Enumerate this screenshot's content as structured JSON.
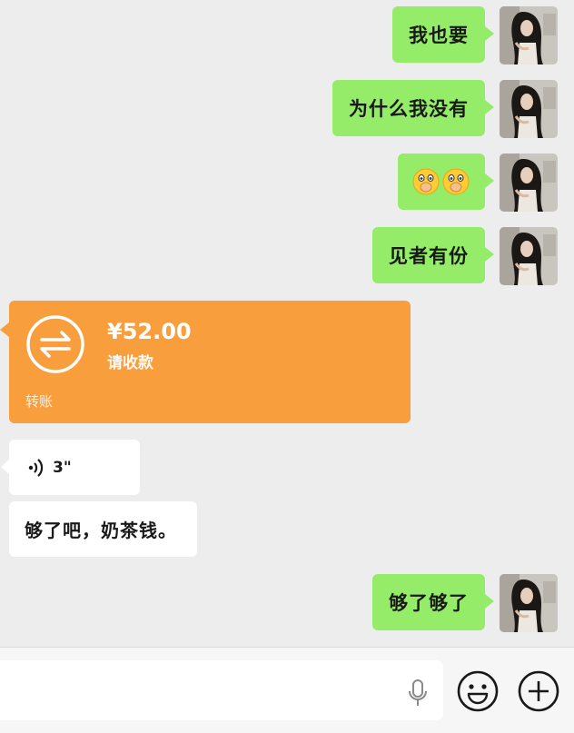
{
  "messages": [
    {
      "side": "right",
      "text": "我也要"
    },
    {
      "side": "right",
      "text": "为什么我没有"
    },
    {
      "side": "right",
      "emoji": "🤭🤭"
    },
    {
      "side": "right",
      "text": "见者有份"
    }
  ],
  "transfer": {
    "amount": "¥52.00",
    "status": "请收款",
    "label": "转账",
    "color": "#f99e3c"
  },
  "voice": {
    "duration": "3\""
  },
  "left_text": {
    "text": "够了吧，奶茶钱。"
  },
  "last_message": {
    "text": "够了够了"
  },
  "colors": {
    "sent_bubble": "#95ec69",
    "background": "#ededed"
  },
  "icons": {
    "mic": "mic-icon",
    "emoji": "emoji-face-icon",
    "plus": "plus-circle-icon"
  }
}
